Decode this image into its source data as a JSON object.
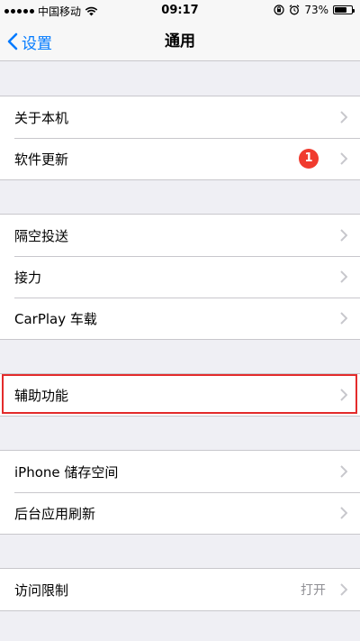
{
  "status_bar": {
    "carrier": "中国移动",
    "time": "09:17",
    "battery_percent": "73%",
    "battery_level": 0.73
  },
  "nav": {
    "back_label": "设置",
    "title": "通用"
  },
  "groups": [
    {
      "items": [
        {
          "label": "关于本机"
        },
        {
          "label": "软件更新",
          "badge": "1"
        }
      ]
    },
    {
      "items": [
        {
          "label": "隔空投送"
        },
        {
          "label": "接力"
        },
        {
          "label": "CarPlay 车载"
        }
      ]
    },
    {
      "items": [
        {
          "label": "辅助功能"
        }
      ]
    },
    {
      "items": [
        {
          "label": "iPhone 储存空间"
        },
        {
          "label": "后台应用刷新"
        }
      ]
    },
    {
      "items": [
        {
          "label": "访问限制",
          "detail": "打开"
        }
      ]
    }
  ],
  "colors": {
    "accent": "#007aff",
    "badge": "#f03b2e",
    "highlight": "#e32b2b",
    "background": "#efeff4"
  }
}
